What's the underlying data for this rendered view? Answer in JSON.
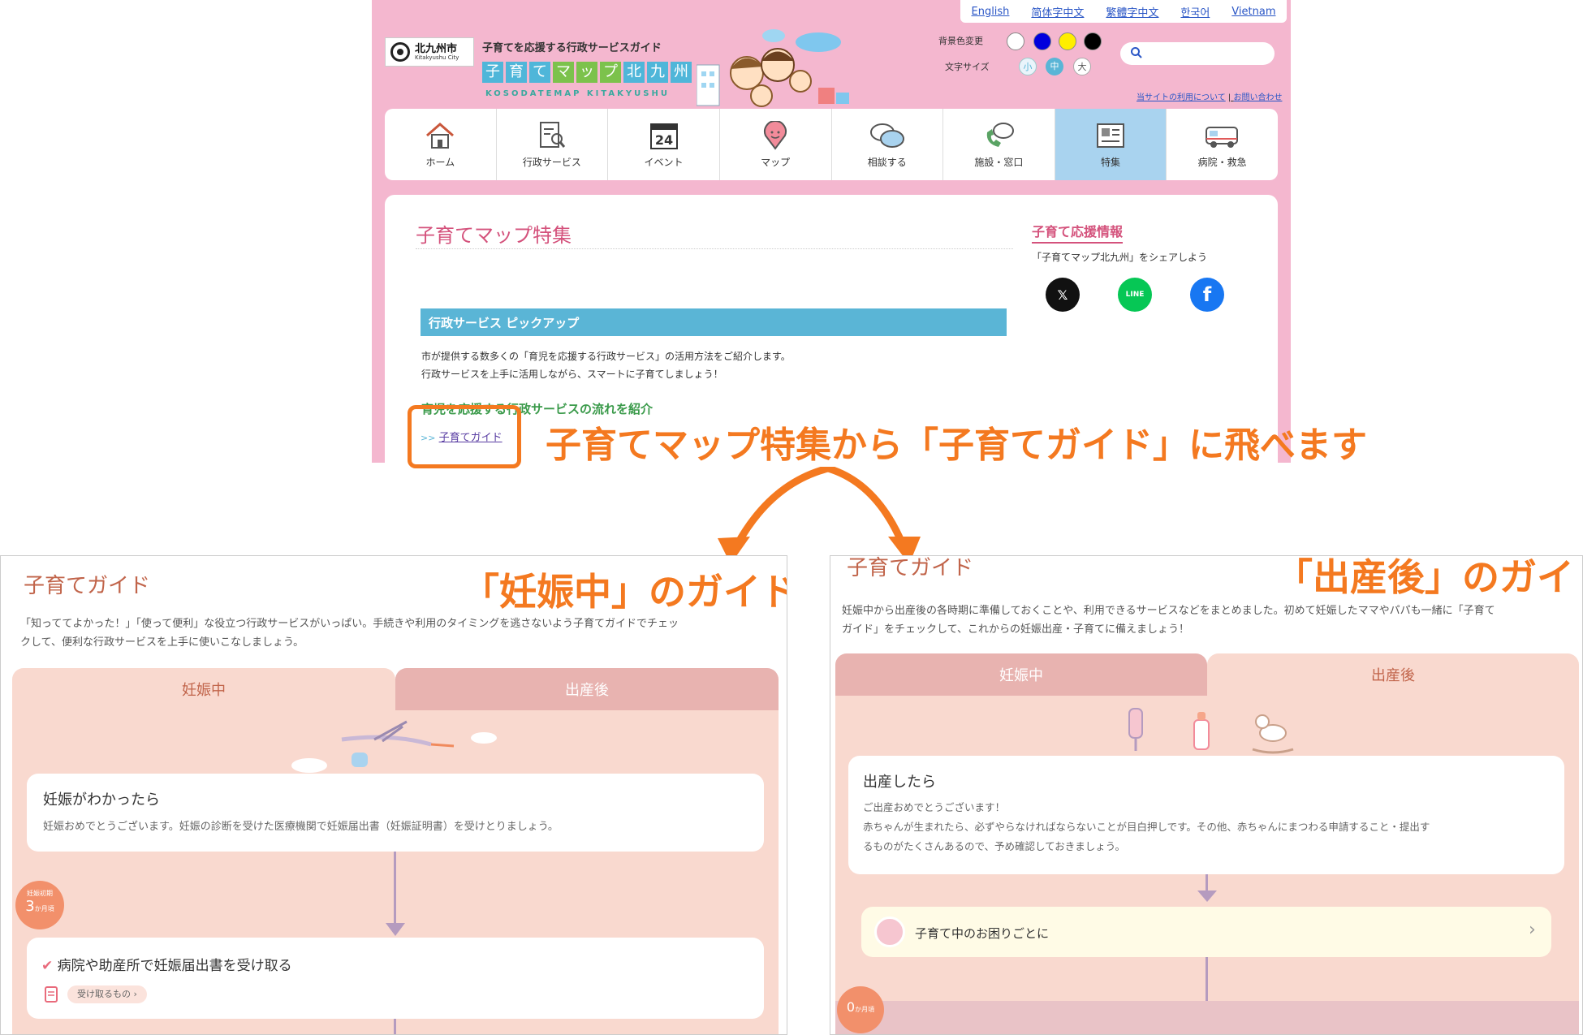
{
  "site": {
    "languages": [
      "English",
      "简体字中文",
      "繁體字中文",
      "한국어",
      "Vietnam"
    ],
    "logo_jp": "北九州市",
    "logo_en": "Kitakyushu City",
    "tagline": "子育てを応援する行政サービスガイド",
    "name_chars": [
      "子",
      "育",
      "て",
      "マ",
      "ッ",
      "プ",
      "北",
      "九",
      "州"
    ],
    "name_colors": [
      "#4fb6d9",
      "#4fb6d9",
      "#4fb6d9",
      "#7cc24c",
      "#7cc24c",
      "#7cc24c",
      "#4fb6d9",
      "#4fb6d9",
      "#4fb6d9"
    ],
    "roman": "KOSODATEMAP KITAKYUSHU",
    "bg_color_label": "背景色変更",
    "bg_colors": [
      "#ffffff",
      "#0000dd",
      "#ffee00",
      "#000000"
    ],
    "font_size_label": "文字サイズ",
    "font_sizes": [
      "小",
      "中",
      "大"
    ],
    "links": [
      "当サイトの利用について",
      "お問い合わせ"
    ],
    "nav": [
      {
        "label": "ホーム",
        "icon": "home-icon"
      },
      {
        "label": "行政サービス",
        "icon": "document-search-icon"
      },
      {
        "label": "イベント",
        "icon": "calendar-icon",
        "day": "24"
      },
      {
        "label": "マップ",
        "icon": "map-pin-icon"
      },
      {
        "label": "相談する",
        "icon": "chat-icon"
      },
      {
        "label": "施設・窓口",
        "icon": "phone-icon"
      },
      {
        "label": "特集",
        "icon": "newspaper-icon",
        "active": true
      },
      {
        "label": "病院・救急",
        "icon": "ambulance-icon"
      }
    ],
    "page_title": "子育てマップ特集",
    "side_title": "子育て応援情報",
    "side_share": "「子育てマップ北九州」をシェアしよう",
    "section_title": "行政サービス ピックアップ",
    "intro_line1": "市が提供する数多くの「育児を応援する行政サービス」の活用方法をご紹介します。",
    "intro_line2": "行政サービスを上手に活用しながら、スマートに子育てしましょう！",
    "flow_heading": "育児を応援する行政サービスの流れを紹介",
    "guide_prefix": ">>",
    "guide_link": "子育てガイド"
  },
  "callout": "子育てマップ特集から「子育てガイド」に飛べます",
  "left_panel": {
    "title": "子育てガイド",
    "big_label": "「妊娠中」のガイド",
    "desc_line1": "「知っててよかった！」「使って便利」な役立つ行政サービスがいっぱい。手続きや利用のタイミングを逃さないよう子育てガイドでチェッ",
    "desc_line2": "クして、便利な行政サービスを上手に使いこなしましょう。",
    "tab_active": "妊娠中",
    "tab_inactive": "出産後",
    "card1_title": "妊娠がわかったら",
    "card1_text": "妊娠おめでとうございます。妊娠の診断を受けた医療機関で妊娠届出書（妊娠証明書）を受けとりましょう。",
    "badge_top": "妊娠初期",
    "badge_num": "3",
    "badge_unit": "か月頃",
    "card2_title": "病院や助産所で妊娠届出書を受け取る",
    "card2_tag": "受け取るもの",
    "check": "✔",
    "chevron": "›"
  },
  "right_panel": {
    "title": "子育てガイド",
    "big_label": "「出産後」のガイド",
    "desc_line1": "妊娠中から出産後の各時期に準備しておくことや、利用できるサービスなどをまとめました。初めて妊娠したママやパパも一緒に「子育て",
    "desc_line2": "ガイド」をチェックして、これからの妊娠出産・子育てに備えましょう！",
    "tab_inactive": "妊娠中",
    "tab_active": "出産後",
    "card1_title": "出産したら",
    "card1_line1": "ご出産おめでとうございます！",
    "card1_line2": "赤ちゃんが生まれたら、必ずやらなければならないことが目白押しです。その他、赤ちゃんにまつわる申請すること・提出す",
    "card1_line3": "るものがたくさんあるので、予め確認しておきましょう。",
    "trouble": "子育て中のお困りごとに",
    "badge_num": "0",
    "badge_unit": "か月頃",
    "chevron": "›"
  },
  "colors": {
    "site_bg": "#f4b7cf",
    "accent_orange": "#f47920",
    "section_blue": "#5ab5d6",
    "title_pink": "#d4527c",
    "panel_salmon": "#f9d9cf"
  }
}
